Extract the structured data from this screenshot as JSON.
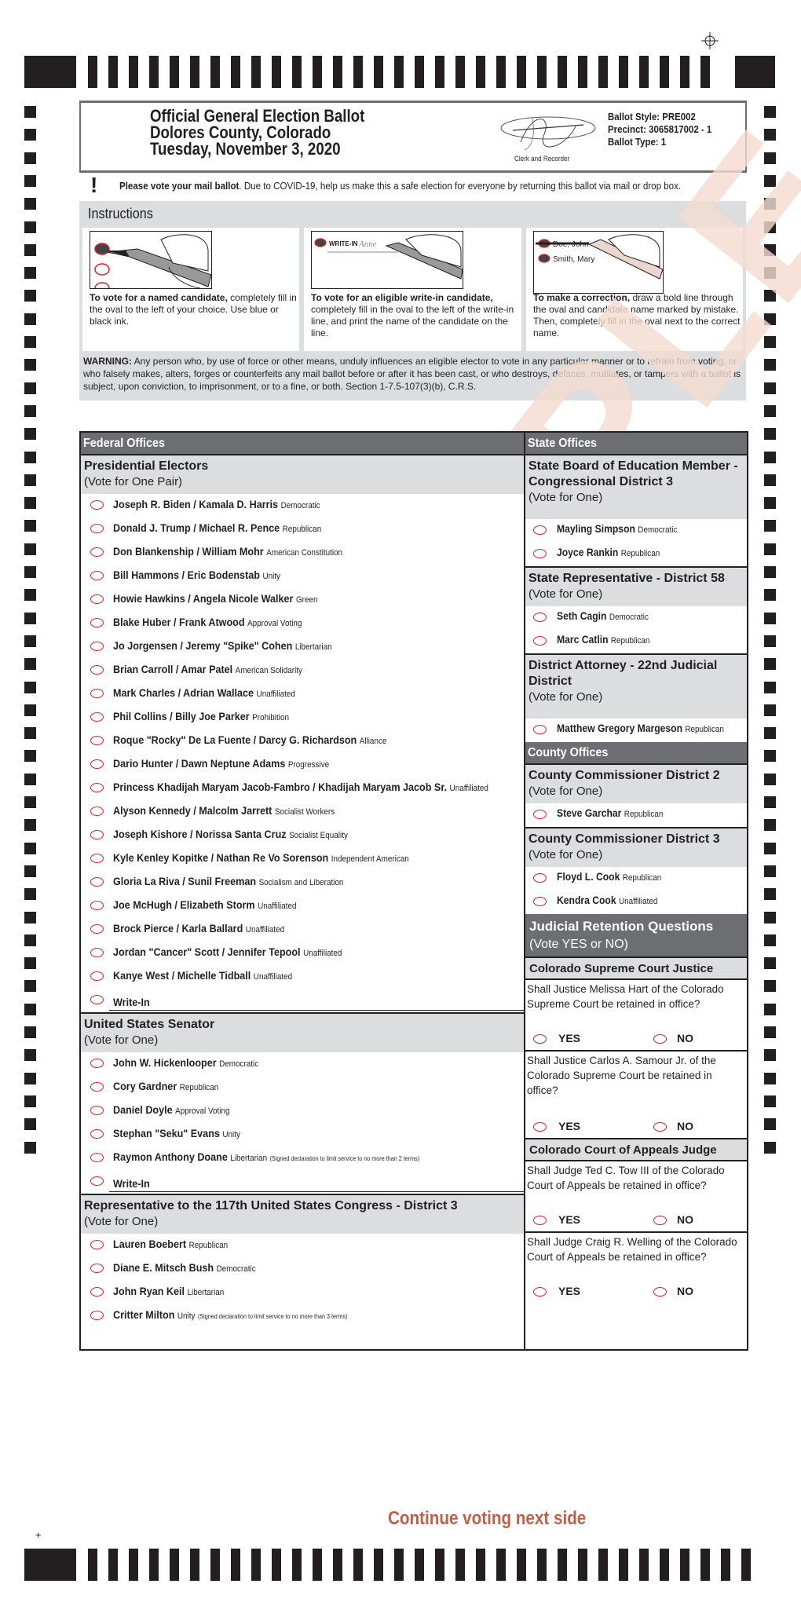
{
  "header": {
    "title_lines": [
      "Official General Election Ballot",
      "Dolores County, Colorado",
      "Tuesday, November 3, 2020"
    ],
    "signature_caption": "Clerk and Recorder",
    "ballot_style": "Ballot Style: PRE002",
    "precinct": "Precinct: 3065817002 - 1",
    "ballot_type": "Ballot Type: 1"
  },
  "notice": {
    "icon": "exclamation-icon",
    "bold": "Please vote your mail ballot",
    "text": ". Due to COVID-19, help us make this a safe election for everyone by returning this ballot via mail or drop box."
  },
  "instructions": {
    "title": "Instructions",
    "panels": [
      {
        "bold": "To vote for a named candidate,",
        "text": " completely fill in the oval to the left of your choice. Use blue or black ink."
      },
      {
        "bold": "To vote for an eligible write-in candidate,",
        "text": " completely fill in the oval to the left of the write-in line, and print the name of the candidate on the line.",
        "image_label": "WRITE-IN",
        "image_script": "Anne"
      },
      {
        "bold": "To make a correction,",
        "text": " draw a bold line through the oval and candidate name marked by mistake. Then, completely fill in the oval next to the correct name.",
        "image_names": [
          "Doe, John",
          "Smith, Mary"
        ]
      }
    ],
    "warning_bold": "WARNING:",
    "warning_text": " Any person who, by use of force or other means, unduly influences an eligible elector to vote in any particular manner or to refrain from voting, or who falsely makes, alters, forges or counterfeits any mail ballot before or after it has been cast, or who destroys, defaces, mutilates, or tampers with a ballot is subject, upon conviction, to imprisonment, or to a fine, or both. Section 1-7.5-107(3)(b), C.R.S."
  },
  "federal": {
    "section_title": "Federal Offices",
    "contests": [
      {
        "title": "Presidential Electors",
        "vote_for": "(Vote for One Pair)",
        "candidates": [
          {
            "name": "Joseph R. Biden / Kamala D. Harris",
            "party": "Democratic"
          },
          {
            "name": "Donald J. Trump / Michael R. Pence",
            "party": "Republican"
          },
          {
            "name": "Don Blankenship / William Mohr",
            "party": "American Constitution"
          },
          {
            "name": "Bill Hammons / Eric Bodenstab",
            "party": "Unity"
          },
          {
            "name": "Howie Hawkins / Angela Nicole Walker",
            "party": "Green"
          },
          {
            "name": "Blake Huber / Frank Atwood",
            "party": "Approval Voting"
          },
          {
            "name": "Jo Jorgensen / Jeremy \"Spike\" Cohen",
            "party": "Libertarian"
          },
          {
            "name": "Brian Carroll / Amar Patel",
            "party": "American Solidarity"
          },
          {
            "name": "Mark Charles / Adrian Wallace",
            "party": "Unaffiliated"
          },
          {
            "name": "Phil Collins / Billy Joe Parker",
            "party": "Prohibition"
          },
          {
            "name": "Roque \"Rocky\" De La Fuente / Darcy G. Richardson",
            "party": "Alliance"
          },
          {
            "name": "Dario Hunter / Dawn Neptune Adams",
            "party": "Progressive"
          },
          {
            "name": "Princess Khadijah Maryam Jacob-Fambro / Khadijah Maryam Jacob Sr.",
            "party": "Unaffiliated"
          },
          {
            "name": "Alyson Kennedy / Malcolm Jarrett",
            "party": "Socialist Workers"
          },
          {
            "name": "Joseph Kishore / Norissa Santa Cruz",
            "party": "Socialist Equality"
          },
          {
            "name": "Kyle Kenley Kopitke / Nathan Re Vo Sorenson",
            "party": "Independent American"
          },
          {
            "name": "Gloria La Riva / Sunil Freeman",
            "party": "Socialism and Liberation"
          },
          {
            "name": "Joe McHugh / Elizabeth Storm",
            "party": "Unaffiliated"
          },
          {
            "name": "Brock Pierce / Karla Ballard",
            "party": "Unaffiliated"
          },
          {
            "name": "Jordan \"Cancer\" Scott / Jennifer Tepool",
            "party": "Unaffiliated"
          },
          {
            "name": "Kanye West / Michelle Tidball",
            "party": "Unaffiliated"
          }
        ],
        "write_in": "Write-In"
      },
      {
        "title": "United States Senator",
        "vote_for": "(Vote for One)",
        "candidates": [
          {
            "name": "John W. Hickenlooper",
            "party": "Democratic"
          },
          {
            "name": "Cory Gardner",
            "party": "Republican"
          },
          {
            "name": "Daniel Doyle",
            "party": "Approval Voting"
          },
          {
            "name": "Stephan \"Seku\" Evans",
            "party": "Unity"
          },
          {
            "name": "Raymon Anthony Doane",
            "party": "Libertarian",
            "note": "(Signed declaration to limit service to no more than 2 terms)"
          }
        ],
        "write_in": "Write-In"
      },
      {
        "title": "Representative to the 117th United States Congress - District 3",
        "vote_for": "(Vote for One)",
        "candidates": [
          {
            "name": "Lauren Boebert",
            "party": "Republican"
          },
          {
            "name": "Diane E. Mitsch Bush",
            "party": "Democratic"
          },
          {
            "name": "John Ryan Keil",
            "party": "Libertarian"
          },
          {
            "name": "Critter Milton",
            "party": "Unity",
            "note": "(Signed declaration to limit service to no more than 3 terms)"
          }
        ]
      }
    ]
  },
  "state": {
    "section_title": "State Offices",
    "contests": [
      {
        "title": "State Board of Education Member - Congressional District 3",
        "vote_for": "(Vote for One)",
        "candidates": [
          {
            "name": "Mayling Simpson",
            "party": "Democratic"
          },
          {
            "name": "Joyce Rankin",
            "party": "Republican"
          }
        ]
      },
      {
        "title": "State Representative - District 58",
        "vote_for": "(Vote for One)",
        "candidates": [
          {
            "name": "Seth Cagin",
            "party": "Democratic"
          },
          {
            "name": "Marc Catlin",
            "party": "Republican"
          }
        ]
      },
      {
        "title": "District Attorney - 22nd Judicial District",
        "vote_for": "(Vote for One)",
        "candidates": [
          {
            "name": "Matthew Gregory Margeson",
            "party": "Republican"
          }
        ]
      }
    ]
  },
  "county": {
    "section_title": "County Offices",
    "contests": [
      {
        "title": "County Commissioner District 2",
        "vote_for": "(Vote for One)",
        "candidates": [
          {
            "name": "Steve Garchar",
            "party": "Republican"
          }
        ]
      },
      {
        "title": "County Commissioner District 3",
        "vote_for": "(Vote for One)",
        "candidates": [
          {
            "name": "Floyd L. Cook",
            "party": "Republican"
          },
          {
            "name": "Kendra Cook",
            "party": "Unaffiliated"
          }
        ]
      }
    ]
  },
  "judicial": {
    "title": "Judicial Retention Questions",
    "subtitle": "(Vote YES or NO)",
    "yes_label": "YES",
    "no_label": "NO",
    "courts": [
      {
        "title": "Colorado Supreme Court Justice",
        "questions": [
          "Shall Justice Melissa Hart of the Colorado Supreme Court be retained in office?",
          "Shall Justice Carlos A. Samour Jr. of the Colorado Supreme Court be retained in office?"
        ]
      },
      {
        "title": "Colorado Court of Appeals Judge",
        "questions": [
          "Shall Judge Ted C. Tow III of the Colorado Court of Appeals be retained in office?",
          "Shall Judge Craig R. Welling of the Colorado Court of Appeals be retained in office?"
        ]
      }
    ]
  },
  "watermark": "SAMPLE",
  "footer": {
    "continue_text": "Continue voting next side"
  },
  "colors": {
    "oval": "#e31e25",
    "section_header": "#6d6e71",
    "contest_header": "#dcdddf",
    "continue": "#c0604a",
    "watermark": "#f4dccf"
  }
}
